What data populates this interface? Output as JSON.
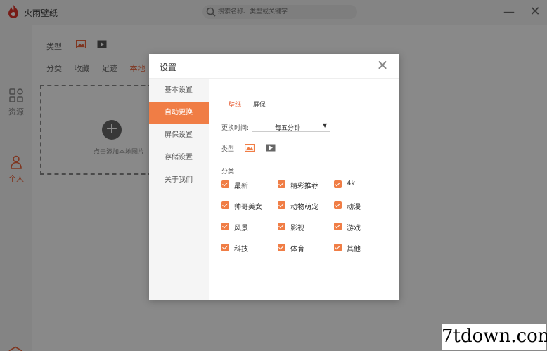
{
  "app": {
    "title": "火雨壁纸",
    "search_placeholder": "搜索名称、类型或关键字"
  },
  "sidebar": {
    "items": [
      {
        "label": "资源"
      },
      {
        "label": "个人"
      }
    ]
  },
  "main": {
    "type_label": "类型",
    "tabs": [
      "分类",
      "收藏",
      "足迹",
      "本地"
    ],
    "active_tab": "本地",
    "upload_text": "点击添加本地图片"
  },
  "modal": {
    "title": "设置",
    "nav": [
      {
        "label": "基本设置"
      },
      {
        "label": "自动更换"
      },
      {
        "label": "屏保设置"
      },
      {
        "label": "存储设置"
      },
      {
        "label": "关于我们"
      }
    ],
    "active_nav": "自动更换",
    "subtabs": [
      "壁纸",
      "屏保"
    ],
    "active_subtab": "壁纸",
    "interval_label": "更换时间:",
    "interval_value": "每五分钟",
    "type_label": "类型",
    "category_label": "分类",
    "categories": [
      {
        "label": "最新",
        "checked": true
      },
      {
        "label": "精彩推荐",
        "checked": true
      },
      {
        "label": "4k",
        "checked": true
      },
      {
        "label": "帅哥美女",
        "checked": true
      },
      {
        "label": "动物萌宠",
        "checked": true
      },
      {
        "label": "动漫",
        "checked": true
      },
      {
        "label": "风景",
        "checked": true
      },
      {
        "label": "影视",
        "checked": true
      },
      {
        "label": "游戏",
        "checked": true
      },
      {
        "label": "科技",
        "checked": true
      },
      {
        "label": "体育",
        "checked": true
      },
      {
        "label": "其他",
        "checked": true
      }
    ]
  },
  "watermark": "7tdown.com",
  "colors": {
    "accent": "#f07d45",
    "accent_text": "#e8623a"
  }
}
